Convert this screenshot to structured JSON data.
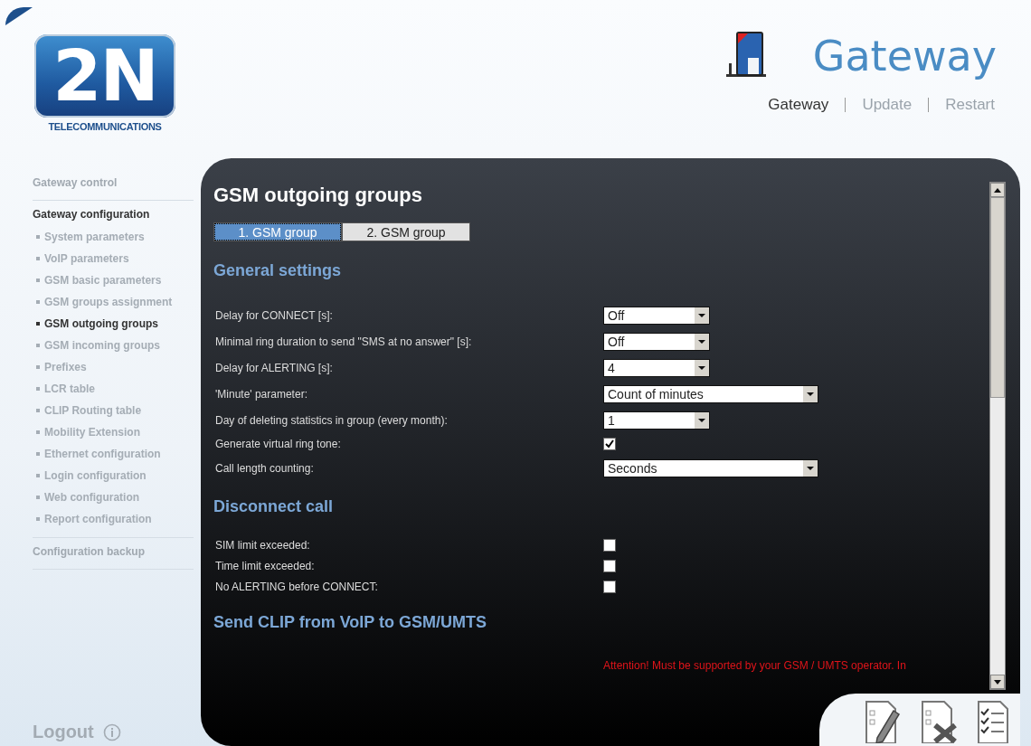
{
  "logo": {
    "mark": "2N",
    "tagline": "TELECOMMUNICATIONS"
  },
  "product": {
    "title": "Gateway"
  },
  "top_nav": [
    {
      "label": "Gateway",
      "selected": true
    },
    {
      "label": "Update",
      "selected": false
    },
    {
      "label": "Restart",
      "selected": false
    }
  ],
  "sidebar": {
    "items": [
      {
        "label": "Gateway control",
        "selected": false
      },
      {
        "label": "Gateway configuration",
        "selected": true,
        "children": [
          {
            "label": "System parameters",
            "selected": false
          },
          {
            "label": "VoIP parameters",
            "selected": false
          },
          {
            "label": "GSM basic parameters",
            "selected": false
          },
          {
            "label": "GSM groups assignment",
            "selected": false
          },
          {
            "label": "GSM outgoing groups",
            "selected": true
          },
          {
            "label": "GSM incoming groups",
            "selected": false
          },
          {
            "label": "Prefixes",
            "selected": false
          },
          {
            "label": "LCR table",
            "selected": false
          },
          {
            "label": "CLIP Routing table",
            "selected": false
          },
          {
            "label": "Mobility Extension",
            "selected": false
          },
          {
            "label": "Ethernet configuration",
            "selected": false
          },
          {
            "label": "Login configuration",
            "selected": false
          },
          {
            "label": "Web configuration",
            "selected": false
          },
          {
            "label": "Report configuration",
            "selected": false
          }
        ]
      },
      {
        "label": "Configuration backup",
        "selected": false
      }
    ],
    "logout": "Logout"
  },
  "page": {
    "title": "GSM outgoing groups",
    "tabs": [
      {
        "label": "1. GSM group",
        "selected": true
      },
      {
        "label": "2. GSM group",
        "selected": false
      }
    ],
    "sections": [
      {
        "title": "General settings",
        "rows": [
          {
            "kind": "short_select",
            "label": "Delay for CONNECT [s]:",
            "value": "Off"
          },
          {
            "kind": "short_select",
            "label": "Minimal ring duration to send \"SMS at no answer\" [s]:",
            "value": "Off"
          },
          {
            "kind": "short_select",
            "label": "Delay for ALERTING [s]:",
            "value": "4"
          },
          {
            "kind": "long_select",
            "label": "'Minute' parameter:",
            "value": "Count of minutes"
          },
          {
            "kind": "short_select",
            "label": "Day of deleting statistics in group (every month):",
            "value": "1"
          },
          {
            "kind": "checkbox",
            "label": "Generate virtual ring tone:",
            "checked": true
          },
          {
            "kind": "long_select",
            "label": "Call length counting:",
            "value": "Seconds"
          }
        ]
      },
      {
        "title": "Disconnect call",
        "rows": [
          {
            "kind": "checkbox",
            "label": "SIM limit exceeded:",
            "checked": false
          },
          {
            "kind": "checkbox",
            "label": "Time limit exceeded:",
            "checked": false
          },
          {
            "kind": "checkbox",
            "label": "No ALERTING before CONNECT:",
            "checked": false
          }
        ]
      },
      {
        "title": "Send CLIP from VoIP to GSM/UMTS",
        "warning": "Attention! Must be supported by your GSM / UMTS operator. In"
      }
    ]
  }
}
